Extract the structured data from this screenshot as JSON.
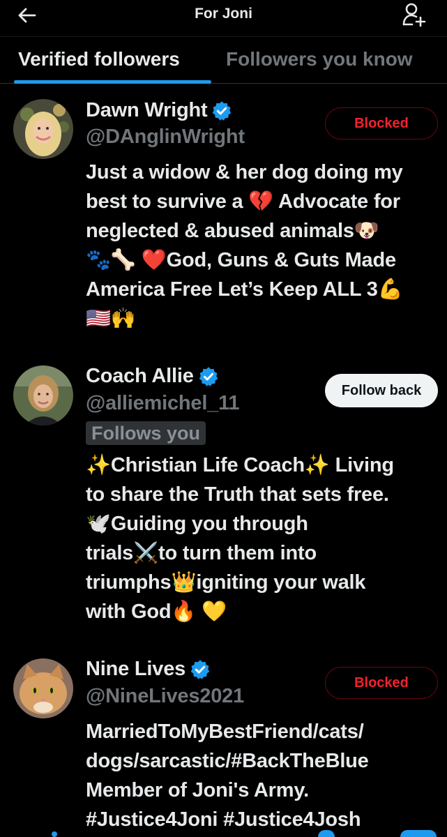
{
  "header": {
    "title": "For Joni"
  },
  "tabs": [
    {
      "label": "Verified followers",
      "active": true
    },
    {
      "label": "Followers you know",
      "active": false
    }
  ],
  "users": [
    {
      "name": "Dawn Wright",
      "handle": "@DAnglinWright",
      "action": "Blocked",
      "bio": "Just a widow & her dog doing my\nbest to survive a 💔 Advocate for\nneglected & abused animals🐶\n🐾🦴 ❤️God, Guns & Guts Made\nAmerica Free Let’s Keep ALL 3💪\n🇺🇸🙌"
    },
    {
      "name": "Coach Allie",
      "handle": "@alliemichel_11",
      "follows_you": "Follows you",
      "action": "Follow back",
      "bio": "✨Christian Life Coach✨ Living\nto share the Truth that sets free.\n🕊️Guiding you through\ntrials⚔️to turn them into\ntriumphs👑igniting your walk\nwith God🔥 💛"
    },
    {
      "name": "Nine Lives",
      "handle": "@NineLives2021",
      "action": "Blocked",
      "bio": "MarriedToMyBestFriend/cats/\ndogs/sarcastic/#BackTheBlue\nMember of Joni's Army.\n#Justice4Joni #Justice4Josh"
    }
  ],
  "colors": {
    "accent": "#1d9bf0",
    "blocked": "#f4212e",
    "muted": "#71767b"
  },
  "icons": [
    "back-arrow-icon",
    "add-user-icon",
    "verified-badge-icon"
  ]
}
